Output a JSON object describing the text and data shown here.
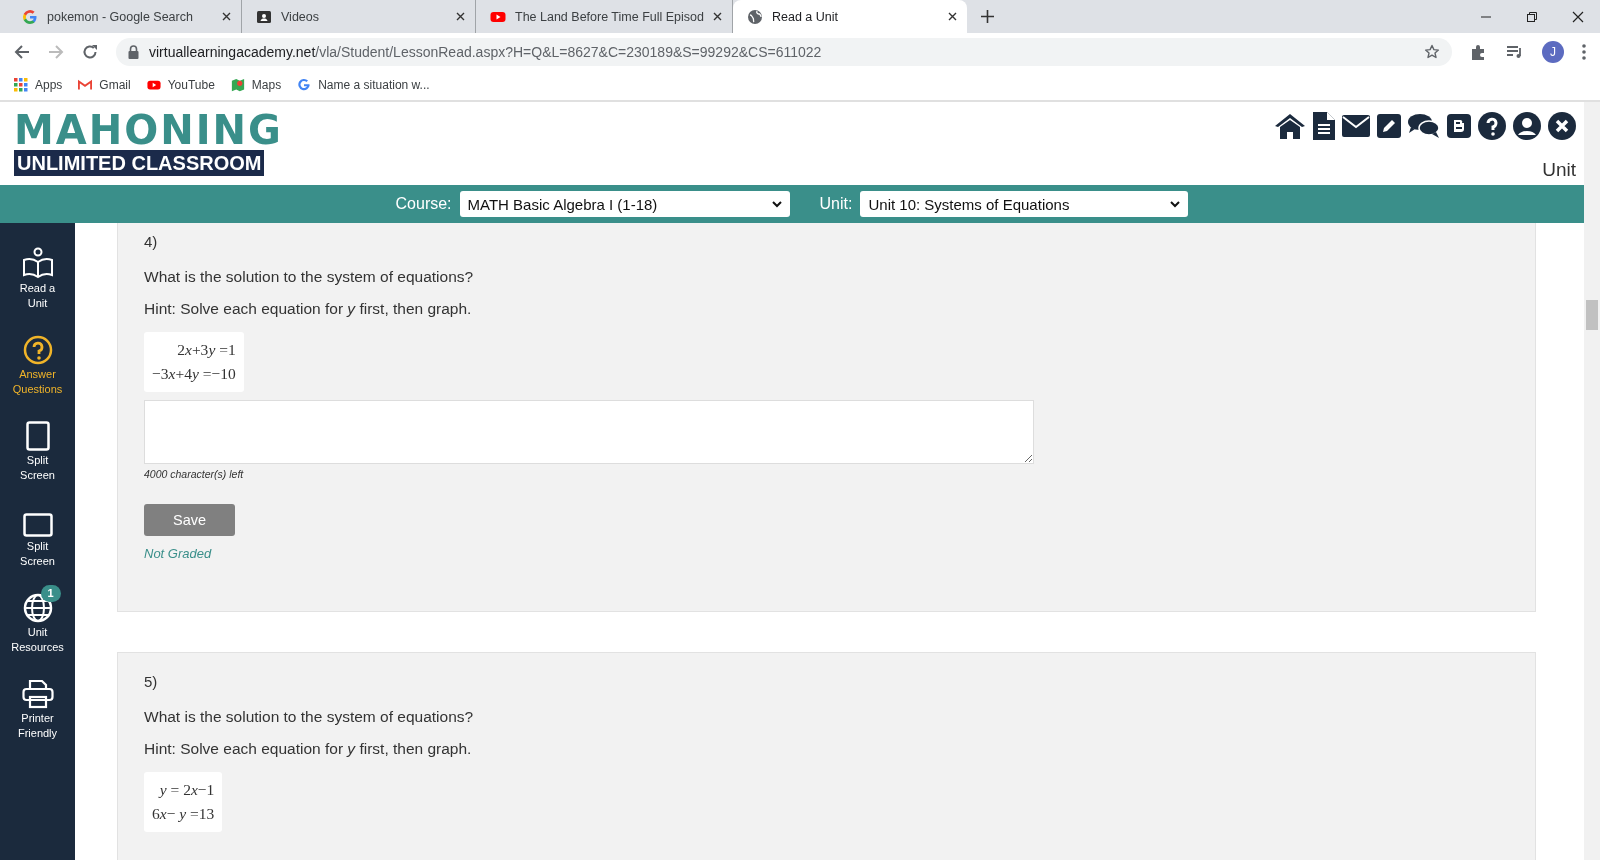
{
  "browser": {
    "tabs": [
      {
        "title": "pokemon - Google Search",
        "kind": "google",
        "selected": false
      },
      {
        "title": "Videos",
        "kind": "videos",
        "selected": false
      },
      {
        "title": "The Land Before Time Full Episod",
        "kind": "youtube",
        "selected": false
      },
      {
        "title": "Read a Unit",
        "kind": "globe",
        "selected": true
      }
    ],
    "address": {
      "domain": "virtuallearningacademy.net",
      "path": "/vla/Student/LessonRead.aspx?H=Q&L=8627&C=230189&S=99292&CS=611022"
    },
    "bookmarks": [
      {
        "label": "Apps",
        "kind": "apps"
      },
      {
        "label": "Gmail",
        "kind": "gmail"
      },
      {
        "label": "YouTube",
        "kind": "youtube"
      },
      {
        "label": "Maps",
        "kind": "maps"
      },
      {
        "label": "Name a situation w...",
        "kind": "google"
      }
    ],
    "avatar": "J"
  },
  "header": {
    "logo_title": "MAHONING",
    "logo_subtitle": "UNLIMITED CLASSROOM",
    "page_label": "Unit"
  },
  "course_bar": {
    "course": {
      "label": "Course:",
      "value": "MATH Basic Algebra I (1-18)"
    },
    "unit": {
      "label": "Unit:",
      "value": "Unit 10: Systems of Equations"
    }
  },
  "sidebar": {
    "items": [
      {
        "label": "Read a Unit",
        "kind": "book",
        "selected": false
      },
      {
        "label": "Answer Questions",
        "kind": "question",
        "selected": true
      },
      {
        "label": "Split Screen",
        "kind": "tablet",
        "selected": false
      },
      {
        "label": "Split Screen",
        "kind": "monitor",
        "selected": false
      },
      {
        "label": "Unit Resources",
        "kind": "globe",
        "selected": false,
        "badge": "1"
      },
      {
        "label": "Printer Friendly",
        "kind": "printer",
        "selected": false
      }
    ]
  },
  "questions": [
    {
      "number": "4)",
      "question": "What is the solution to the system of equations?",
      "hint": "Hint:  Solve each equation for *y* first, then graph.",
      "equations": [
        [
          "2",
          "*x*",
          "+3",
          "*y*",
          " =1"
        ],
        [
          "−3",
          "*x*",
          "+4",
          "*y*",
          " =−10"
        ]
      ],
      "answer": {
        "counter": "4000 character(s) left"
      },
      "save": "Save",
      "status": "Not Graded"
    },
    {
      "number": "5)",
      "question": "What is the solution to the system of equations?",
      "hint": "Hint:  Solve each equation for *y* first, then graph.",
      "equations": [
        [
          "*y*",
          " = 2",
          "*x*",
          "−1"
        ],
        [
          "6",
          "*x*",
          "− ",
          "*y*",
          " =13"
        ]
      ]
    }
  ]
}
